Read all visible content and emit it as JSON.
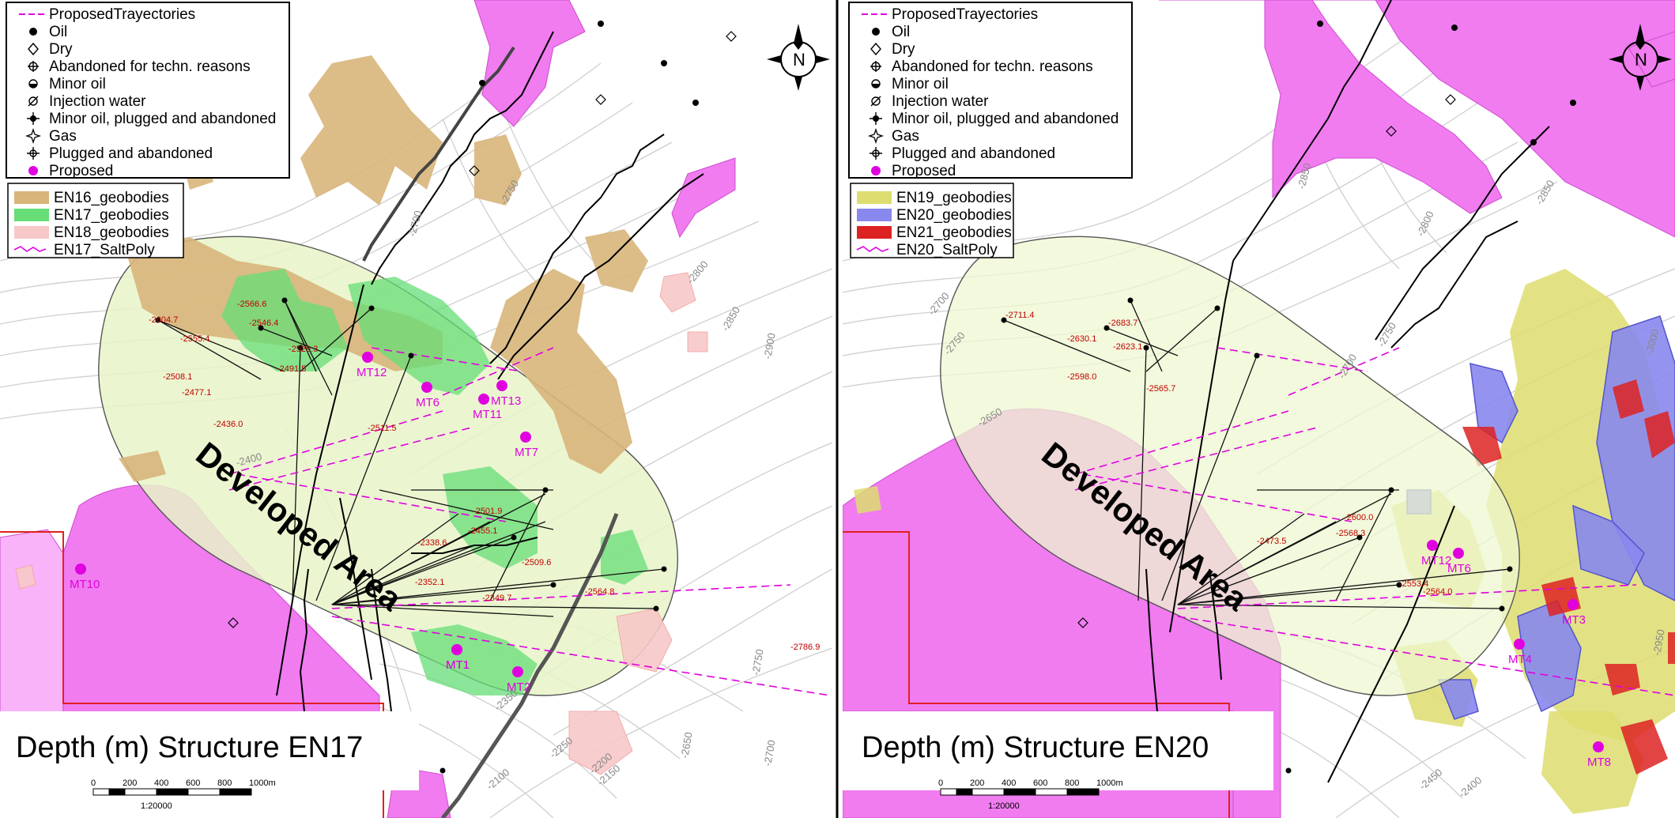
{
  "panels": [
    {
      "title": "Depth (m) Structure EN17",
      "developed_area_label": "Developed Area",
      "legend_wells": [
        {
          "symbol": "trajectory-icon",
          "label": "ProposedTrayectories"
        },
        {
          "symbol": "oil-icon",
          "label": "Oil"
        },
        {
          "symbol": "dry-icon",
          "label": "Dry"
        },
        {
          "symbol": "abandoned-tech-icon",
          "label": "Abandoned for techn. reasons"
        },
        {
          "symbol": "minor-oil-icon",
          "label": "Minor oil"
        },
        {
          "symbol": "injection-water-icon",
          "label": "Injection water"
        },
        {
          "symbol": "minor-oil-pa-icon",
          "label": "Minor oil, plugged and abandoned"
        },
        {
          "symbol": "gas-icon",
          "label": "Gas"
        },
        {
          "symbol": "plugged-abandoned-icon",
          "label": "Plugged and abandoned"
        },
        {
          "symbol": "proposed-icon",
          "label": "Proposed"
        }
      ],
      "legend_bodies": [
        {
          "swatch": "#d8b57a",
          "label": "EN16_geobodies"
        },
        {
          "swatch": "#66dd77",
          "label": "EN17_geobodies"
        },
        {
          "swatch": "#f7c8c8",
          "label": "EN18_geobodies"
        },
        {
          "swatch": "line-magenta",
          "label": "EN17_SaltPoly"
        }
      ],
      "contour_labels": [
        "-2700",
        "-2750",
        "-2800",
        "-2850",
        "-2900",
        "-2400",
        "-2350",
        "-2250",
        "-2200",
        "-2150",
        "-2100",
        "-2750",
        "-2700",
        "-2650"
      ],
      "well_labels": [
        "-2604.7",
        "-2566.6",
        "-2546.4",
        "-2555.4",
        "-2529.3",
        "-2508.1",
        "-2491.5",
        "-2477.1",
        "-2436.0",
        "-2511.5",
        "-2501.9",
        "-2455.1",
        "-2338.6",
        "-2509.6",
        "-2352.1",
        "-2349.7",
        "-2564.8",
        "-2786.9"
      ],
      "proposed_wells": [
        "MT12",
        "MT6",
        "MT13",
        "MT11",
        "MT7",
        "MT10",
        "MT1",
        "MT2",
        "MT1"
      ],
      "scale_ticks": [
        "0",
        "200",
        "400",
        "600",
        "800",
        "1000m"
      ],
      "scale_ratio": "1:20000"
    },
    {
      "title": "Depth (m) Structure EN20",
      "developed_area_label": "Developed Area",
      "legend_wells": [
        {
          "symbol": "trajectory-icon",
          "label": "ProposedTrayectories"
        },
        {
          "symbol": "oil-icon",
          "label": "Oil"
        },
        {
          "symbol": "dry-icon",
          "label": "Dry"
        },
        {
          "symbol": "abandoned-tech-icon",
          "label": "Abandoned for techn. reasons"
        },
        {
          "symbol": "minor-oil-icon",
          "label": "Minor oil"
        },
        {
          "symbol": "injection-water-icon",
          "label": "Injection water"
        },
        {
          "symbol": "minor-oil-pa-icon",
          "label": "Minor oil, plugged and abandoned"
        },
        {
          "symbol": "gas-icon",
          "label": "Gas"
        },
        {
          "symbol": "plugged-abandoned-icon",
          "label": "Plugged and abandoned"
        },
        {
          "symbol": "proposed-icon",
          "label": "Proposed"
        }
      ],
      "legend_bodies": [
        {
          "swatch": "#dddd70",
          "label": "EN19_geobodies"
        },
        {
          "swatch": "#8888ee",
          "label": "EN20_geobodies"
        },
        {
          "swatch": "#dd2222",
          "label": "EN21_geobodies"
        },
        {
          "swatch": "line-magenta",
          "label": "EN20_SaltPoly"
        }
      ],
      "contour_labels": [
        "-2850",
        "-2800",
        "-2750",
        "-2700",
        "-2850",
        "-3000",
        "-2750",
        "-2700",
        "-2650",
        "-2450",
        "-2400",
        "-2950"
      ],
      "well_labels": [
        "-2711.4",
        "-2683.7",
        "-2630.1",
        "-2623.1",
        "-2598.0",
        "-2565.7",
        "-2600.0",
        "-2568.3",
        "-2473.5",
        "-2553.4",
        "-2564.0"
      ],
      "proposed_wells": [
        "MT12",
        "MT6",
        "MT3",
        "MT4",
        "MT8"
      ],
      "scale_ticks": [
        "0",
        "200",
        "400",
        "600",
        "800",
        "1000m"
      ],
      "scale_ratio": "1:20000"
    }
  ],
  "colors": {
    "salt": "#f07cf0",
    "developed_area": "#e8f5c8",
    "fault": "#000000",
    "proposed": "#e000e0",
    "contour": "#c8c8c8",
    "well_label": "#c00000"
  }
}
